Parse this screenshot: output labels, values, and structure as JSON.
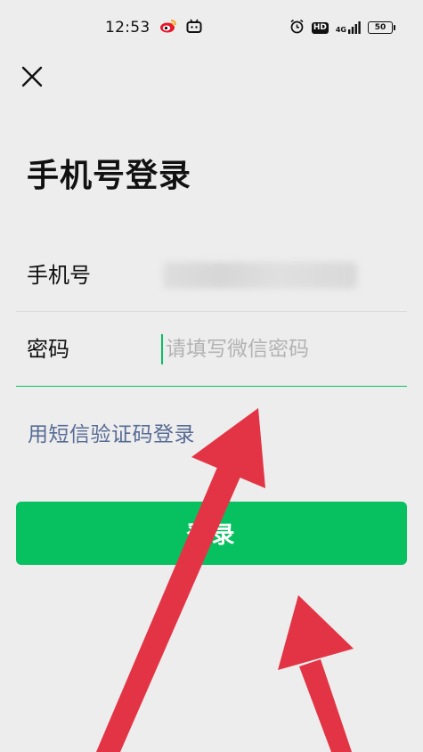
{
  "status_bar": {
    "time": "12:53",
    "hd": "HD",
    "network": "4G",
    "battery": "50",
    "icons": [
      "weibo-icon",
      "bilibili-icon",
      "alarm-icon",
      "hd-icon",
      "signal-icon",
      "battery-icon"
    ]
  },
  "header": {
    "close_icon": "close-icon"
  },
  "main": {
    "title": "手机号登录",
    "phone_label": "手机号",
    "password_label": "密码",
    "password_placeholder": "请填写微信密码",
    "sms_login_link": "用短信验证码登录",
    "login_button": "登录"
  },
  "colors": {
    "accent": "#07c160",
    "link": "#576b95",
    "background": "#ededed",
    "annotation_arrow": "#e33445"
  }
}
